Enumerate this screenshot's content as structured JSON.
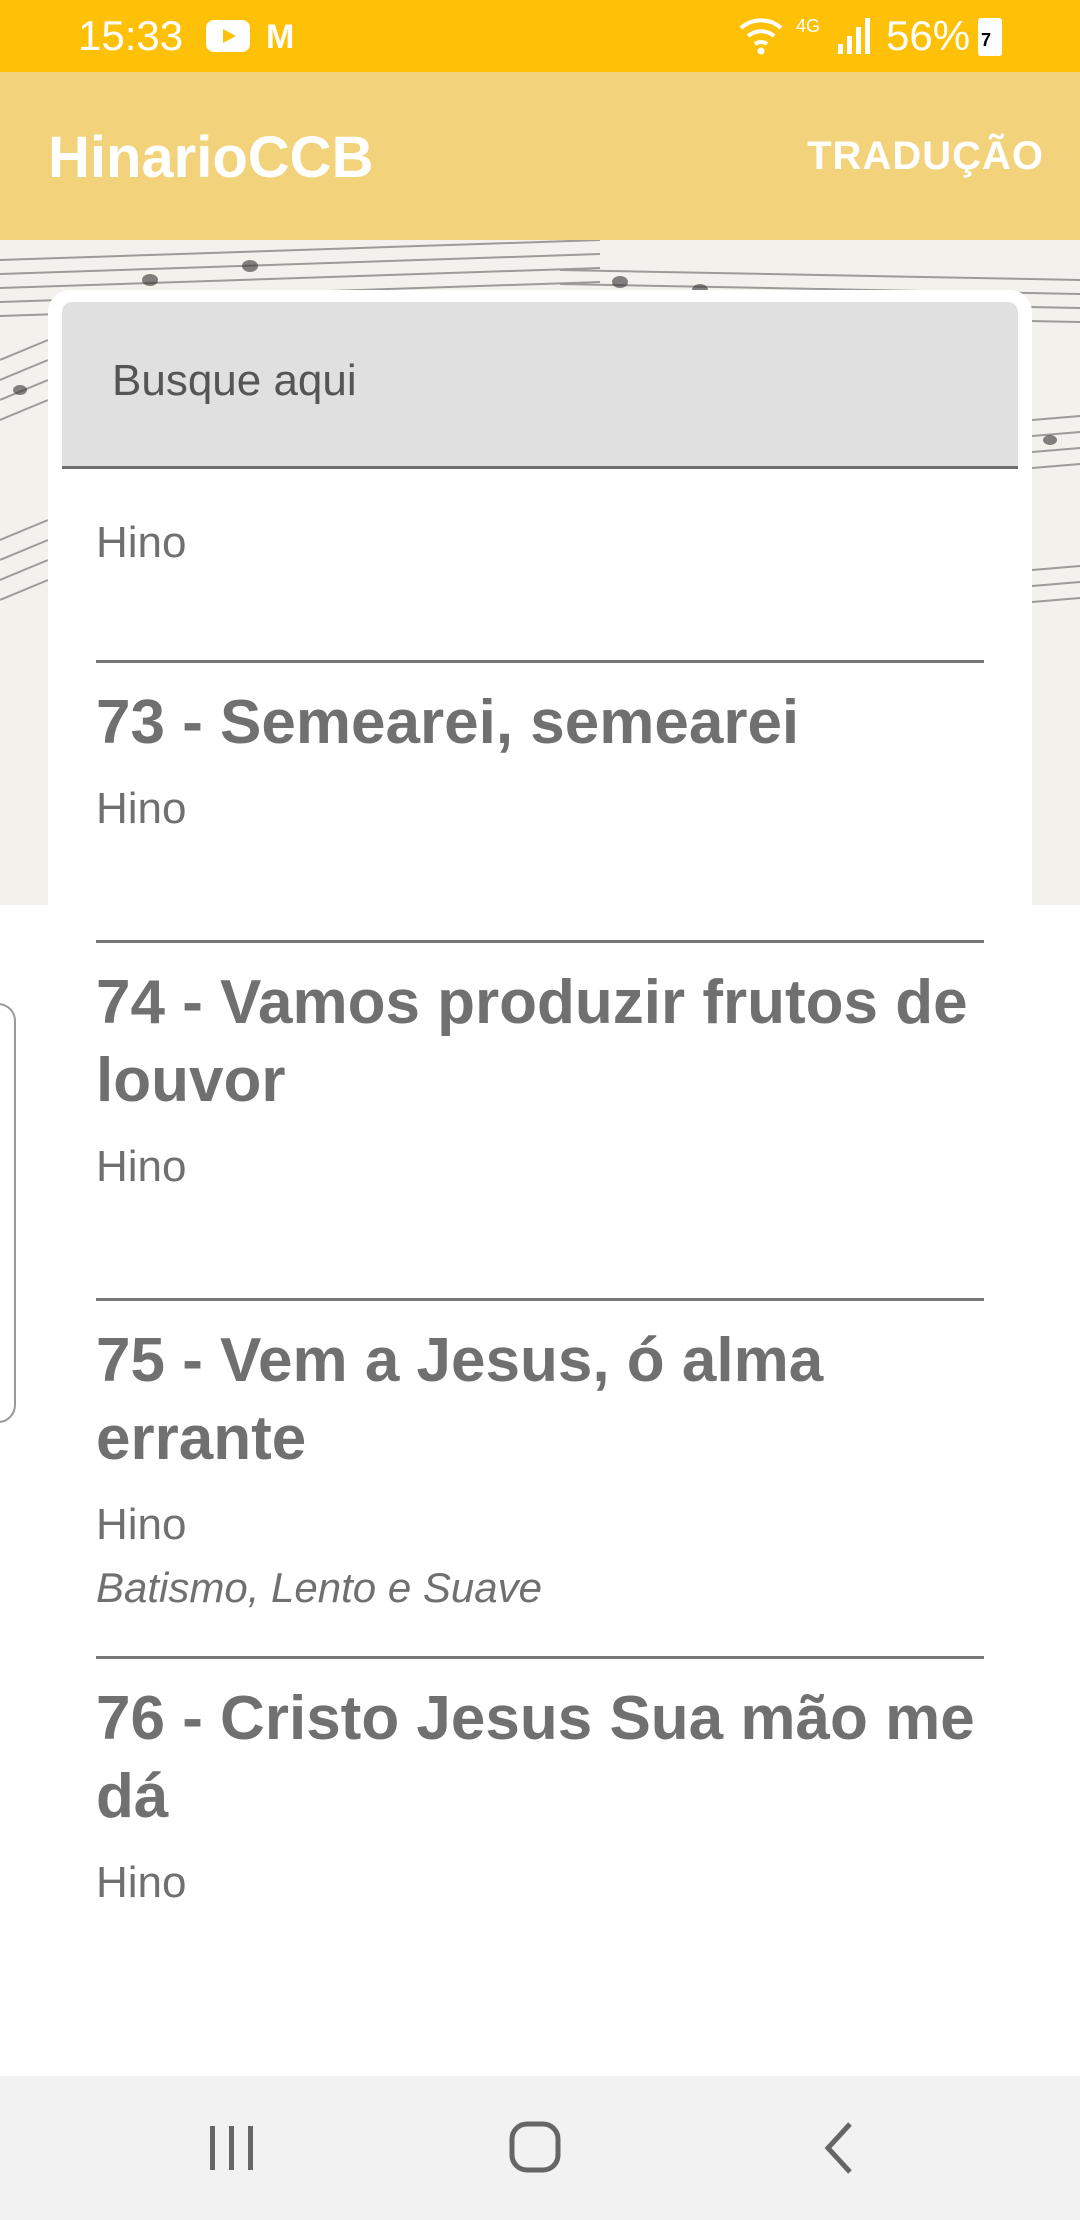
{
  "status_bar": {
    "time": "15:33",
    "network": "4G",
    "battery": "56%",
    "battery_badge": "7",
    "icons": [
      "youtube-icon",
      "gmail-icon",
      "wifi-icon",
      "signal-icon",
      "battery-icon"
    ]
  },
  "app_bar": {
    "title": "HinarioCCB",
    "translate_label": "TRADUÇÃO"
  },
  "search": {
    "placeholder": "Busque aqui"
  },
  "hymns": {
    "partial_subtitle": "Hino",
    "items": [
      {
        "title": "73 - Semearei, semearei",
        "subtitle": "Hino",
        "tags": ""
      },
      {
        "title": "74 - Vamos produzir frutos de louvor",
        "subtitle": "Hino",
        "tags": ""
      },
      {
        "title": "75 - Vem a Jesus, ó alma errante",
        "subtitle": "Hino",
        "tags": "Batismo, Lento e Suave"
      },
      {
        "title": "76 - Cristo Jesus Sua mão me dá",
        "subtitle": "Hino",
        "tags": ""
      }
    ]
  },
  "nav_bar": {
    "buttons": [
      "recents-icon",
      "home-icon",
      "back-icon"
    ]
  },
  "colors": {
    "status_bar": "#FFC107",
    "app_bar": "#F2D27A",
    "text": "#707070"
  }
}
